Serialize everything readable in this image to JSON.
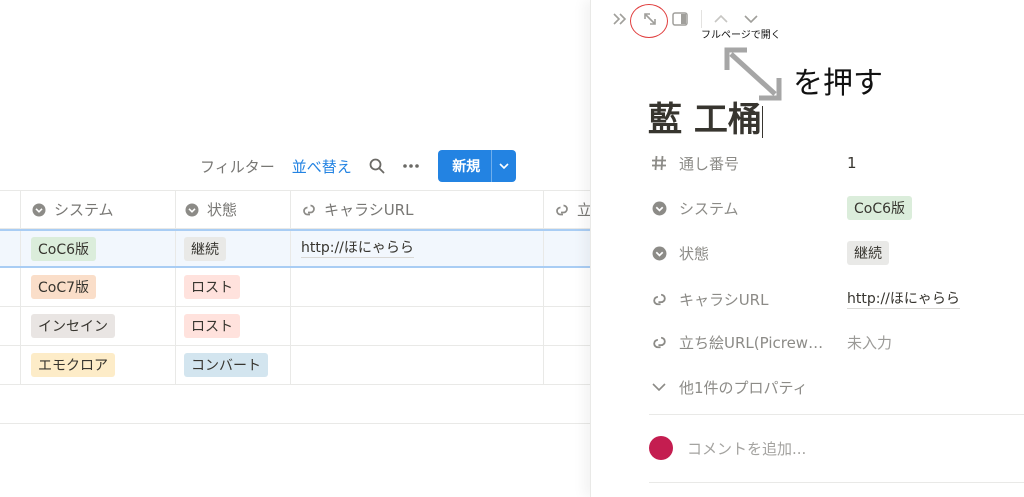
{
  "colors": {
    "accent": "#2383e2",
    "tag_coc6": "#dbeddb",
    "tag_coc7": "#fadec9",
    "tag_insane": "#e9e5e3",
    "tag_emoklore": "#fdecc8",
    "tag_keizoku": "#e9e9e7",
    "tag_lost": "#ffe2dd",
    "tag_convert": "#d3e5ef",
    "highlight_circle": "#e03e3e",
    "avatar": "#c41d50"
  },
  "toolbar": {
    "filter_label": "フィルター",
    "sort_label": "並べ替え",
    "search_icon": "search-icon",
    "more_icon": "more-icon",
    "new_label": "新規"
  },
  "table": {
    "columns": [
      {
        "label": "システム",
        "icon": "select-icon"
      },
      {
        "label": "状態",
        "icon": "select-icon"
      },
      {
        "label": "キャラシURL",
        "icon": "url-icon"
      },
      {
        "label": "立",
        "icon": "url-icon"
      }
    ],
    "rows": [
      {
        "system": "CoC6版",
        "system_color": "#dbeddb",
        "status": "継続",
        "status_color": "#e9e9e7",
        "url": "http://ほにゃらら"
      },
      {
        "system": "CoC7版",
        "system_color": "#fadec9",
        "status": "ロスト",
        "status_color": "#ffe2dd",
        "url": ""
      },
      {
        "system": "インセイン",
        "system_color": "#e9e5e3",
        "status": "ロスト",
        "status_color": "#ffe2dd",
        "url": ""
      },
      {
        "system": "エモクロア",
        "system_color": "#fdecc8",
        "status": "コンバート",
        "status_color": "#d3e5ef",
        "url": ""
      }
    ]
  },
  "panel": {
    "tooltip": "フルページで開く",
    "annotation": "を押す",
    "title": "藍 工桶",
    "properties": [
      {
        "label": "通し番号",
        "value": "1",
        "icon": "number-icon"
      },
      {
        "label": "システム",
        "value": "CoC6版",
        "icon": "select-icon",
        "tag_color": "#dbeddb"
      },
      {
        "label": "状態",
        "value": "継続",
        "icon": "select-icon",
        "tag_color": "#e9e9e7"
      },
      {
        "label": "キャラシURL",
        "value": "http://ほにゃらら",
        "icon": "url-icon"
      },
      {
        "label": "立ち絵URL(Picrew…",
        "value": "未入力",
        "icon": "url-icon"
      }
    ],
    "more_props": "他1件のプロパティ",
    "comment_placeholder": "コメントを追加..."
  }
}
